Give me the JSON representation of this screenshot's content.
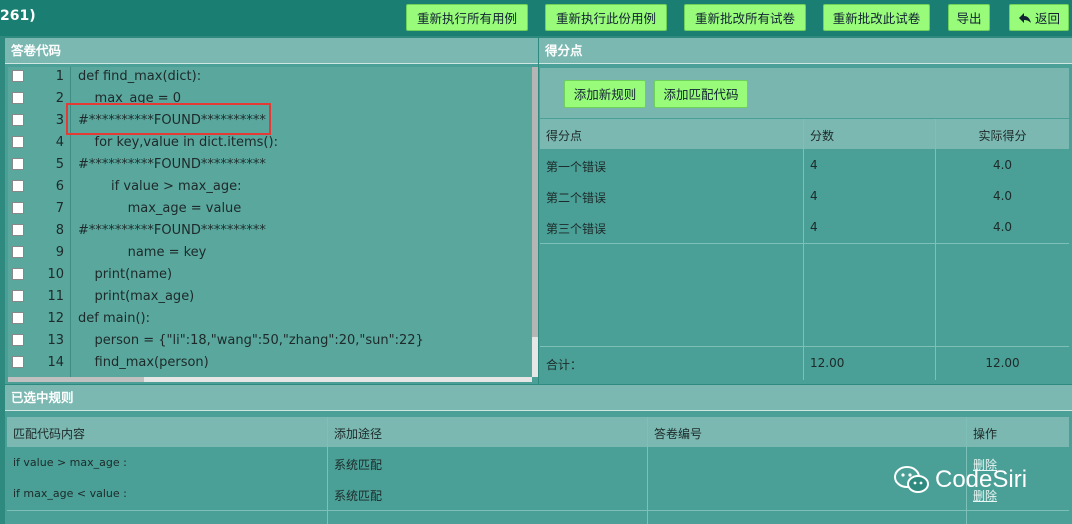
{
  "topbar": {
    "title": "261)",
    "buttons": {
      "rerun_all": "重新执行所有用例",
      "rerun_this": "重新执行此份用例",
      "regrade_all": "重新批改所有试卷",
      "regrade_this": "重新批改此试卷",
      "export": "导出",
      "back": "返回"
    }
  },
  "code_panel": {
    "header": "答卷代码",
    "lines": [
      {
        "num": "1",
        "text": "def find_max(dict):"
      },
      {
        "num": "2",
        "text": "    max_age = 0"
      },
      {
        "num": "3",
        "text": "#**********FOUND**********"
      },
      {
        "num": "4",
        "text": "    for key,value in dict.items():"
      },
      {
        "num": "5",
        "text": "#**********FOUND**********"
      },
      {
        "num": "6",
        "text": "        if value > max_age:"
      },
      {
        "num": "7",
        "text": "            max_age = value"
      },
      {
        "num": "8",
        "text": "#**********FOUND**********"
      },
      {
        "num": "9",
        "text": "            name = key"
      },
      {
        "num": "10",
        "text": "    print(name)"
      },
      {
        "num": "11",
        "text": "    print(max_age)"
      },
      {
        "num": "12",
        "text": "def main():"
      },
      {
        "num": "13",
        "text": "    person = {\"li\":18,\"wang\":50,\"zhang\":20,\"sun\":22}"
      },
      {
        "num": "14",
        "text": "    find_max(person)"
      }
    ]
  },
  "score_panel": {
    "header": "得分点",
    "add_rule": "添加新规则",
    "add_match": "添加匹配代码",
    "columns": [
      "得分点",
      "分数",
      "实际得分"
    ],
    "rows": [
      {
        "name": "第一个错误",
        "score": "4",
        "actual": "4.0"
      },
      {
        "name": "第二个错误",
        "score": "4",
        "actual": "4.0"
      },
      {
        "name": "第三个错误",
        "score": "4",
        "actual": "4.0"
      }
    ],
    "total_label": "合计：",
    "total_score": "12.00",
    "total_actual": "12.00"
  },
  "rules_panel": {
    "header": "已选中规则",
    "columns": [
      "匹配代码内容",
      "添加途径",
      "答卷编号",
      "操作"
    ],
    "rows": [
      {
        "content": "if value > max_age :",
        "source": "系统匹配",
        "paper": "",
        "action": "删除"
      },
      {
        "content": "if max_age < value :",
        "source": "系统匹配",
        "paper": "",
        "action": "删除"
      }
    ]
  },
  "watermark": "CodeSiri",
  "colors": {
    "accent_green": "#98fb7a",
    "highlight_red": "#e53935",
    "teal": "#4a9f96"
  }
}
